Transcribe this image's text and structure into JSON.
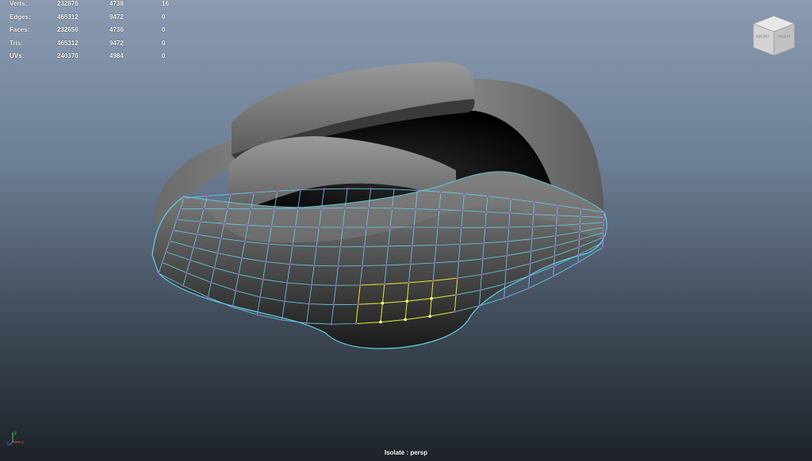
{
  "hud": {
    "rows": [
      {
        "label": "Verts:",
        "c1": "232876",
        "c2": "4738",
        "c3": "16"
      },
      {
        "label": "Edges:",
        "c1": "465312",
        "c2": "9472",
        "c3": "0"
      },
      {
        "label": "Faces:",
        "c1": "232656",
        "c2": "4736",
        "c3": "0"
      },
      {
        "label": "Tris:",
        "c1": "465312",
        "c2": "9472",
        "c3": "0"
      },
      {
        "label": "UVs:",
        "c1": "240370",
        "c2": "4984",
        "c3": "0"
      }
    ]
  },
  "viewcube": {
    "front": "FRONT",
    "right": "RIGHT"
  },
  "axis": {
    "x": "x",
    "y": "y",
    "z": "z"
  },
  "camera": {
    "label": "Isolate : persp"
  },
  "colors": {
    "wireframe": "#5fd3e8",
    "vertex": "#c040d0",
    "selected_wire": "#e0e020",
    "selected_vertex": "#ffffa0"
  }
}
